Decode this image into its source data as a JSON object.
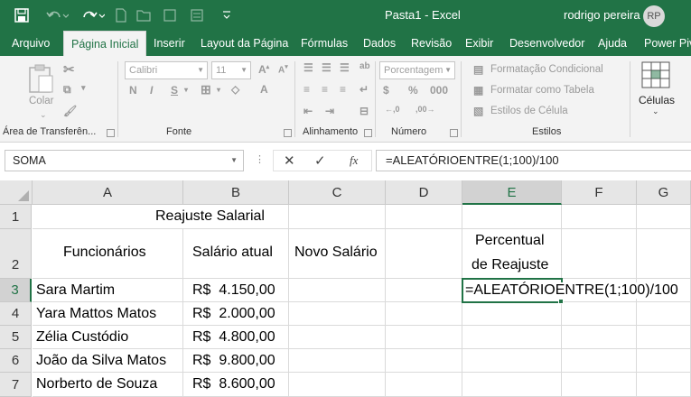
{
  "titlebar": {
    "title": "Pasta1  -  Excel",
    "user": "rodrigo pereira",
    "avatar": "RP",
    "icons": [
      "save-icon",
      "undo-icon",
      "redo-icon",
      "new-file-icon",
      "open-file-icon",
      "checkbox-icon",
      "customize-qat-icon"
    ]
  },
  "tabs": [
    {
      "label": "Arquivo"
    },
    {
      "label": "Página Inicial"
    },
    {
      "label": "Inserir"
    },
    {
      "label": "Layout da Página"
    },
    {
      "label": "Fórmulas"
    },
    {
      "label": "Dados"
    },
    {
      "label": "Revisão"
    },
    {
      "label": "Exibir"
    },
    {
      "label": "Desenvolvedor"
    },
    {
      "label": "Ajuda"
    },
    {
      "label": "Power Pivot"
    }
  ],
  "ribbon": {
    "clipboard": {
      "paste": "Colar",
      "label": "Área de Transferên..."
    },
    "font": {
      "name": "Calibri",
      "size": "11",
      "bold": "N",
      "italic": "I",
      "underline": "S",
      "label": "Fonte"
    },
    "alignment": {
      "label": "Alinhamento"
    },
    "number": {
      "format": "Porcentagem",
      "label": "Número"
    },
    "styles": {
      "conditional": "Formatação Condicional",
      "table": "Formatar como Tabela",
      "cell_styles": "Estilos de Célula",
      "label": "Estilos"
    },
    "cells": {
      "label": "Células"
    }
  },
  "formula_bar": {
    "name_box": "SOMA",
    "cancel": "✕",
    "enter": "✓",
    "fx": "fx",
    "formula": "=ALEATÓRIOENTRE(1;100)/100"
  },
  "sheet": {
    "columns": [
      "A",
      "B",
      "C",
      "D",
      "E",
      "F",
      "G"
    ],
    "rows": [
      "1",
      "2",
      "3",
      "4",
      "5",
      "6",
      "7"
    ],
    "title": "Reajuste Salarial",
    "headers": {
      "funcionarios": "Funcionários",
      "salario_atual": "Salário atual",
      "novo_salario": "Novo Salário",
      "percentual_line1": "Percentual",
      "percentual_line2": "de Reajuste"
    },
    "employees": [
      {
        "name": "Sara Martim",
        "salary": "R$  4.150,00"
      },
      {
        "name": "Yara Mattos Matos",
        "salary": "R$  2.000,00"
      },
      {
        "name": "Zélia Custódio",
        "salary": "R$  4.800,00"
      },
      {
        "name": "João da Silva Matos",
        "salary": "R$  9.800,00"
      },
      {
        "name": "Norberto de Souza",
        "salary": "R$  8.600,00"
      }
    ],
    "editing_cell": "E3",
    "editing_value": "=ALEATÓRIOENTRE(1;100)/100"
  },
  "colors": {
    "accent": "#217346",
    "ribbon_bg": "#f3f3f3",
    "header_bg": "#e6e6e6"
  }
}
